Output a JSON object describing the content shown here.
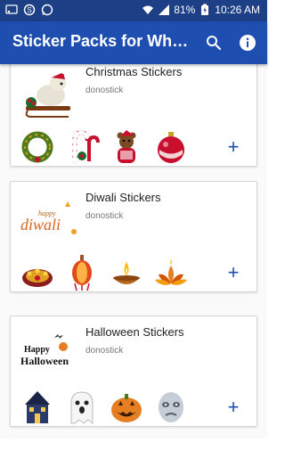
{
  "status_bar": {
    "battery": "81%",
    "time": "10:26 AM"
  },
  "app_bar": {
    "title": "Sticker Packs for Whats...",
    "search_icon": "search-icon",
    "info_icon": "info-icon"
  },
  "packs": [
    {
      "name": "Christmas Stickers",
      "author": "donostick",
      "add_label": "+"
    },
    {
      "name": "Diwali Stickers",
      "author": "donostick",
      "add_label": "+"
    },
    {
      "name": "Halloween Stickers",
      "author": "donostick",
      "add_label": "+"
    }
  ],
  "thumb_text": {
    "diwali_happy": "happy",
    "diwali_word": "diwali",
    "halloween_happy": "Happy",
    "halloween_word": "Halloween"
  },
  "colors": {
    "status_bar": "#1c3f86",
    "app_bar": "#1e4fb0",
    "accent": "#1e4fb0"
  }
}
